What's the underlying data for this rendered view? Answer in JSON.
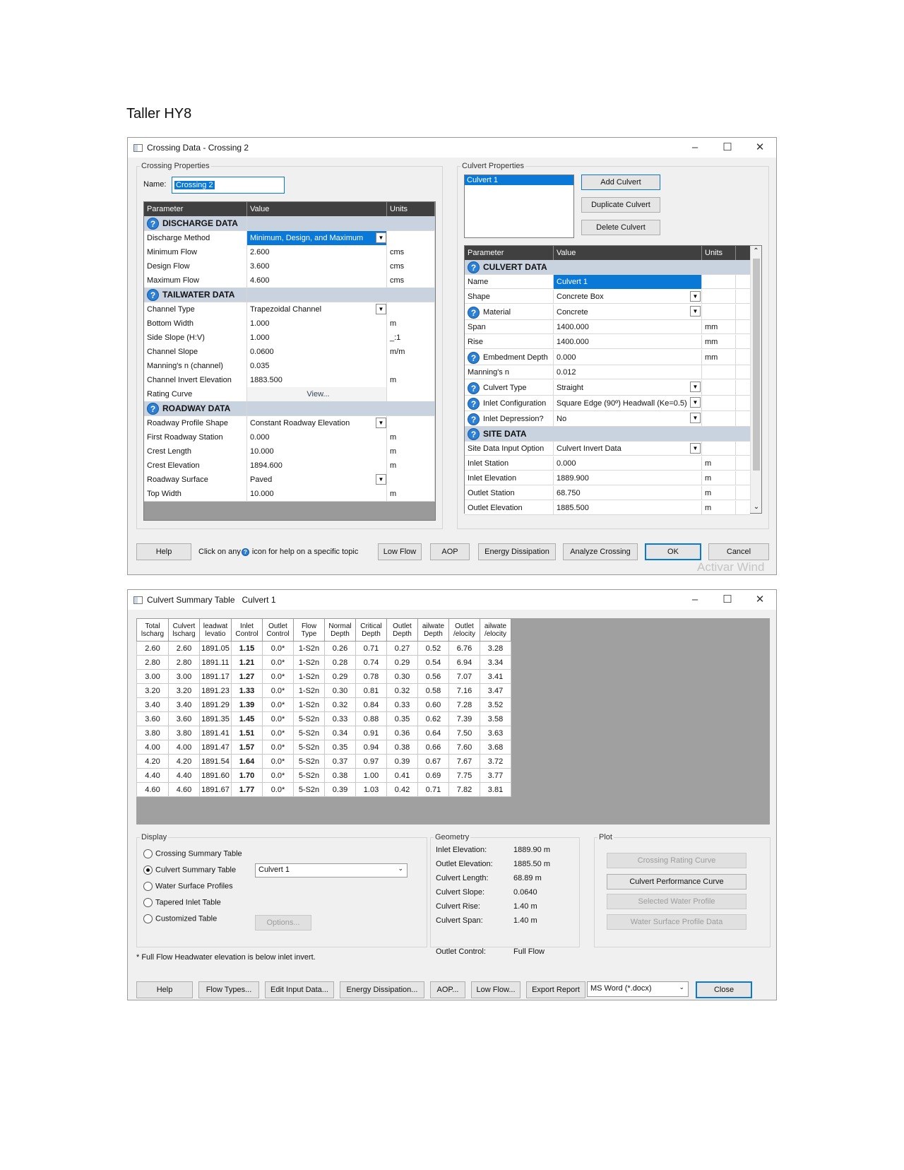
{
  "doc_title": "Taller HY8",
  "crossing_window": {
    "title": "Crossing Data - Crossing 2",
    "controls": {
      "minimize": "–",
      "maximize": "☐",
      "close": "✕"
    },
    "crossing_properties": {
      "legend": "Crossing Properties",
      "name_label": "Name:",
      "name_value": "Crossing 2",
      "headers": {
        "parameter": "Parameter",
        "value": "Value",
        "units": "Units"
      },
      "sections": {
        "discharge": "DISCHARGE DATA",
        "tailwater": "TAILWATER DATA",
        "roadway": "ROADWAY DATA"
      },
      "discharge_rows": [
        {
          "param": "Discharge Method",
          "value": "Minimum, Design, and Maximum",
          "units": ""
        },
        {
          "param": "Minimum Flow",
          "value": "2.600",
          "units": "cms"
        },
        {
          "param": "Design Flow",
          "value": "3.600",
          "units": "cms"
        },
        {
          "param": "Maximum Flow",
          "value": "4.600",
          "units": "cms"
        }
      ],
      "tailwater_rows": [
        {
          "param": "Channel Type",
          "value": "Trapezoidal Channel",
          "units": ""
        },
        {
          "param": "Bottom Width",
          "value": "1.000",
          "units": "m"
        },
        {
          "param": "Side Slope (H:V)",
          "value": "1.000",
          "units": "_:1"
        },
        {
          "param": "Channel Slope",
          "value": "0.0600",
          "units": "m/m"
        },
        {
          "param": "Manning's n (channel)",
          "value": "0.035",
          "units": ""
        },
        {
          "param": "Channel Invert Elevation",
          "value": "1883.500",
          "units": "m"
        },
        {
          "param": "Rating Curve",
          "value": "View...",
          "units": ""
        }
      ],
      "roadway_rows": [
        {
          "param": "Roadway Profile Shape",
          "value": "Constant Roadway Elevation",
          "units": ""
        },
        {
          "param": "First Roadway Station",
          "value": "0.000",
          "units": "m"
        },
        {
          "param": "Crest Length",
          "value": "10.000",
          "units": "m"
        },
        {
          "param": "Crest Elevation",
          "value": "1894.600",
          "units": "m"
        },
        {
          "param": "Roadway Surface",
          "value": "Paved",
          "units": ""
        },
        {
          "param": "Top Width",
          "value": "10.000",
          "units": "m"
        }
      ]
    },
    "culvert_properties": {
      "legend": "Culvert Properties",
      "list": [
        "Culvert 1"
      ],
      "buttons": {
        "add": "Add Culvert",
        "duplicate": "Duplicate Culvert",
        "delete": "Delete Culvert"
      },
      "headers": {
        "parameter": "Parameter",
        "value": "Value",
        "units": "Units"
      },
      "sections": {
        "culvert": "CULVERT DATA",
        "site": "SITE DATA"
      },
      "culvert_rows": [
        {
          "param": "Name",
          "value": "Culvert 1",
          "units": ""
        },
        {
          "param": "Shape",
          "value": "Concrete Box",
          "units": ""
        },
        {
          "param": "Material",
          "value": "Concrete",
          "units": ""
        },
        {
          "param": "Span",
          "value": "1400.000",
          "units": "mm"
        },
        {
          "param": "Rise",
          "value": "1400.000",
          "units": "mm"
        },
        {
          "param": "Embedment Depth",
          "value": "0.000",
          "units": "mm"
        },
        {
          "param": "Manning's n",
          "value": "0.012",
          "units": ""
        },
        {
          "param": "Culvert Type",
          "value": "Straight",
          "units": ""
        },
        {
          "param": "Inlet Configuration",
          "value": "Square Edge (90º) Headwall (Ke=0.5)",
          "units": ""
        },
        {
          "param": "Inlet Depression?",
          "value": "No",
          "units": ""
        }
      ],
      "site_rows": [
        {
          "param": "Site Data Input Option",
          "value": "Culvert Invert Data",
          "units": ""
        },
        {
          "param": "Inlet Station",
          "value": "0.000",
          "units": "m"
        },
        {
          "param": "Inlet Elevation",
          "value": "1889.900",
          "units": "m"
        },
        {
          "param": "Outlet Station",
          "value": "68.750",
          "units": "m"
        },
        {
          "param": "Outlet Elevation",
          "value": "1885.500",
          "units": "m"
        }
      ]
    },
    "footer": {
      "help": "Help",
      "hint_pre": "Click on any",
      "hint_post": "icon for help on a specific topic",
      "low_flow": "Low Flow",
      "aop": "AOP",
      "energy": "Energy Dissipation",
      "analyze": "Analyze Crossing",
      "ok": "OK",
      "cancel": "Cancel"
    },
    "watermark": "Activar Wind"
  },
  "summary_window": {
    "title": "Culvert Summary Table   Culvert 1",
    "controls": {
      "minimize": "–",
      "maximize": "☐",
      "close": "✕"
    },
    "table": {
      "headers": [
        [
          "Total",
          "lscharg"
        ],
        [
          "Culvert",
          "lscharg"
        ],
        [
          "leadwat",
          "levatio"
        ],
        [
          "Inlet",
          "Control"
        ],
        [
          "Outlet",
          "Control"
        ],
        [
          "Flow",
          "Type"
        ],
        [
          "Normal",
          "Depth"
        ],
        [
          "Critical",
          "Depth"
        ],
        [
          "Outlet",
          "Depth"
        ],
        [
          "ailwate",
          "Depth"
        ],
        [
          "Outlet",
          "/elocity"
        ],
        [
          "ailwate",
          "/elocity"
        ]
      ],
      "rows": [
        [
          "2.60",
          "2.60",
          "1891.05",
          "1.15",
          "0.0*",
          "1-S2n",
          "0.26",
          "0.71",
          "0.27",
          "0.52",
          "6.76",
          "3.28"
        ],
        [
          "2.80",
          "2.80",
          "1891.11",
          "1.21",
          "0.0*",
          "1-S2n",
          "0.28",
          "0.74",
          "0.29",
          "0.54",
          "6.94",
          "3.34"
        ],
        [
          "3.00",
          "3.00",
          "1891.17",
          "1.27",
          "0.0*",
          "1-S2n",
          "0.29",
          "0.78",
          "0.30",
          "0.56",
          "7.07",
          "3.41"
        ],
        [
          "3.20",
          "3.20",
          "1891.23",
          "1.33",
          "0.0*",
          "1-S2n",
          "0.30",
          "0.81",
          "0.32",
          "0.58",
          "7.16",
          "3.47"
        ],
        [
          "3.40",
          "3.40",
          "1891.29",
          "1.39",
          "0.0*",
          "1-S2n",
          "0.32",
          "0.84",
          "0.33",
          "0.60",
          "7.28",
          "3.52"
        ],
        [
          "3.60",
          "3.60",
          "1891.35",
          "1.45",
          "0.0*",
          "5-S2n",
          "0.33",
          "0.88",
          "0.35",
          "0.62",
          "7.39",
          "3.58"
        ],
        [
          "3.80",
          "3.80",
          "1891.41",
          "1.51",
          "0.0*",
          "5-S2n",
          "0.34",
          "0.91",
          "0.36",
          "0.64",
          "7.50",
          "3.63"
        ],
        [
          "4.00",
          "4.00",
          "1891.47",
          "1.57",
          "0.0*",
          "5-S2n",
          "0.35",
          "0.94",
          "0.38",
          "0.66",
          "7.60",
          "3.68"
        ],
        [
          "4.20",
          "4.20",
          "1891.54",
          "1.64",
          "0.0*",
          "5-S2n",
          "0.37",
          "0.97",
          "0.39",
          "0.67",
          "7.67",
          "3.72"
        ],
        [
          "4.40",
          "4.40",
          "1891.60",
          "1.70",
          "0.0*",
          "5-S2n",
          "0.38",
          "1.00",
          "0.41",
          "0.69",
          "7.75",
          "3.77"
        ],
        [
          "4.60",
          "4.60",
          "1891.67",
          "1.77",
          "0.0*",
          "5-S2n",
          "0.39",
          "1.03",
          "0.42",
          "0.71",
          "7.82",
          "3.81"
        ]
      ]
    },
    "display": {
      "legend": "Display",
      "options": [
        "Crossing Summary Table",
        "Culvert Summary Table",
        "Water Surface Profiles",
        "Tapered Inlet Table",
        "Customized Table"
      ],
      "culvert_select": "Culvert 1",
      "options_btn": "Options..."
    },
    "geometry": {
      "legend": "Geometry",
      "rows": [
        {
          "label": "Inlet Elevation:",
          "value": "1889.90 m"
        },
        {
          "label": "Outlet Elevation:",
          "value": "1885.50 m"
        },
        {
          "label": "Culvert Length:",
          "value": "68.89 m"
        },
        {
          "label": "Culvert Slope:",
          "value": "0.0640"
        },
        {
          "label": "Culvert Rise:",
          "value": "1.40 m"
        },
        {
          "label": "Culvert Span:",
          "value": "1.40 m"
        }
      ],
      "outlet_control_label": "Outlet Control:",
      "outlet_control_value": "Full Flow"
    },
    "plot": {
      "legend": "Plot",
      "buttons": [
        "Crossing Rating Curve",
        "Culvert Performance Curve",
        "Selected Water Profile",
        "Water Surface Profile Data"
      ]
    },
    "note": "* Full Flow Headwater elevation is below inlet invert.",
    "footer": {
      "help": "Help",
      "flow_types": "Flow Types...",
      "edit_input": "Edit Input Data...",
      "energy": "Energy Dissipation...",
      "aop": "AOP...",
      "low_flow": "Low Flow...",
      "export": "Export Report",
      "format": "MS Word (*.docx)",
      "close": "Close"
    }
  }
}
